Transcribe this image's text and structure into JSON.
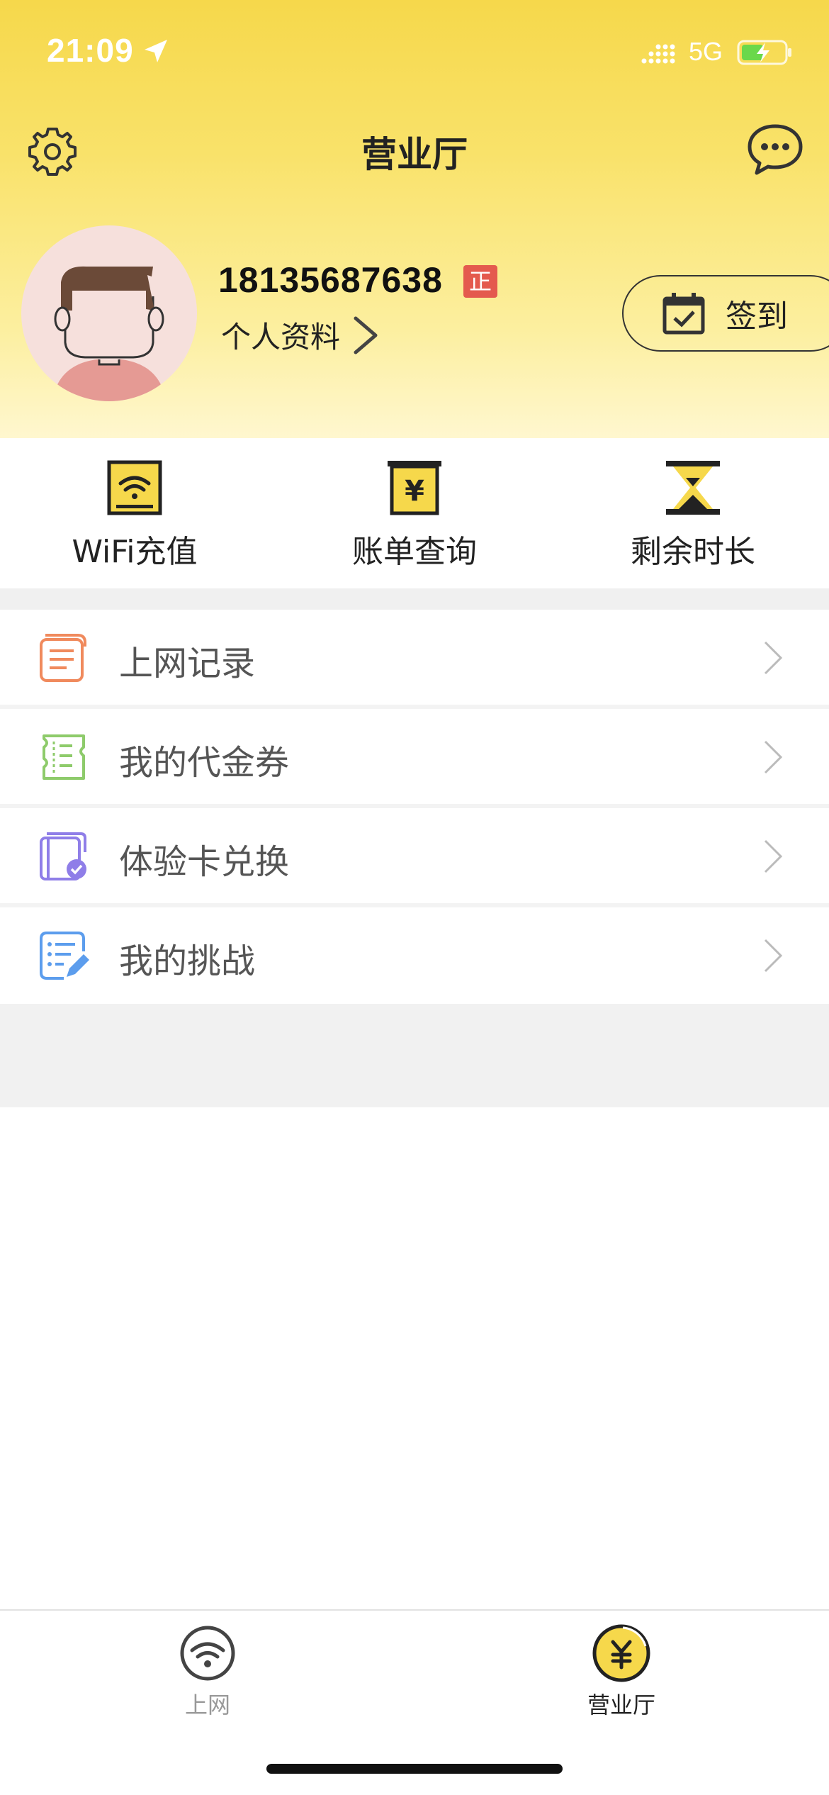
{
  "status_bar": {
    "time": "21:09",
    "network": "5G"
  },
  "nav": {
    "title": "营业厅",
    "settings_icon": "gear-icon",
    "message_icon": "chat-bubble-icon"
  },
  "profile": {
    "phone": "18135687638",
    "badge": "正",
    "link_label": "个人资料",
    "checkin_label": "签到"
  },
  "quick_actions": [
    {
      "label": "WiFi充值",
      "icon": "wifi-recharge-icon"
    },
    {
      "label": "账单查询",
      "icon": "bill-icon"
    },
    {
      "label": "剩余时长",
      "icon": "hourglass-icon"
    }
  ],
  "menu": [
    {
      "label": "上网记录",
      "icon": "record-list-icon",
      "color": "#f08a5d"
    },
    {
      "label": "我的代金券",
      "icon": "voucher-icon",
      "color": "#8ecb6b"
    },
    {
      "label": "体验卡兑换",
      "icon": "card-exchange-icon",
      "color": "#8f7ee8"
    },
    {
      "label": "我的挑战",
      "icon": "challenge-icon",
      "color": "#5c9ded"
    }
  ],
  "tabbar": [
    {
      "label": "上网",
      "icon": "wifi-icon",
      "active": false
    },
    {
      "label": "营业厅",
      "icon": "yuan-icon",
      "active": true
    }
  ],
  "colors": {
    "accent": "#f6d84b",
    "badge": "#e45a4e"
  }
}
